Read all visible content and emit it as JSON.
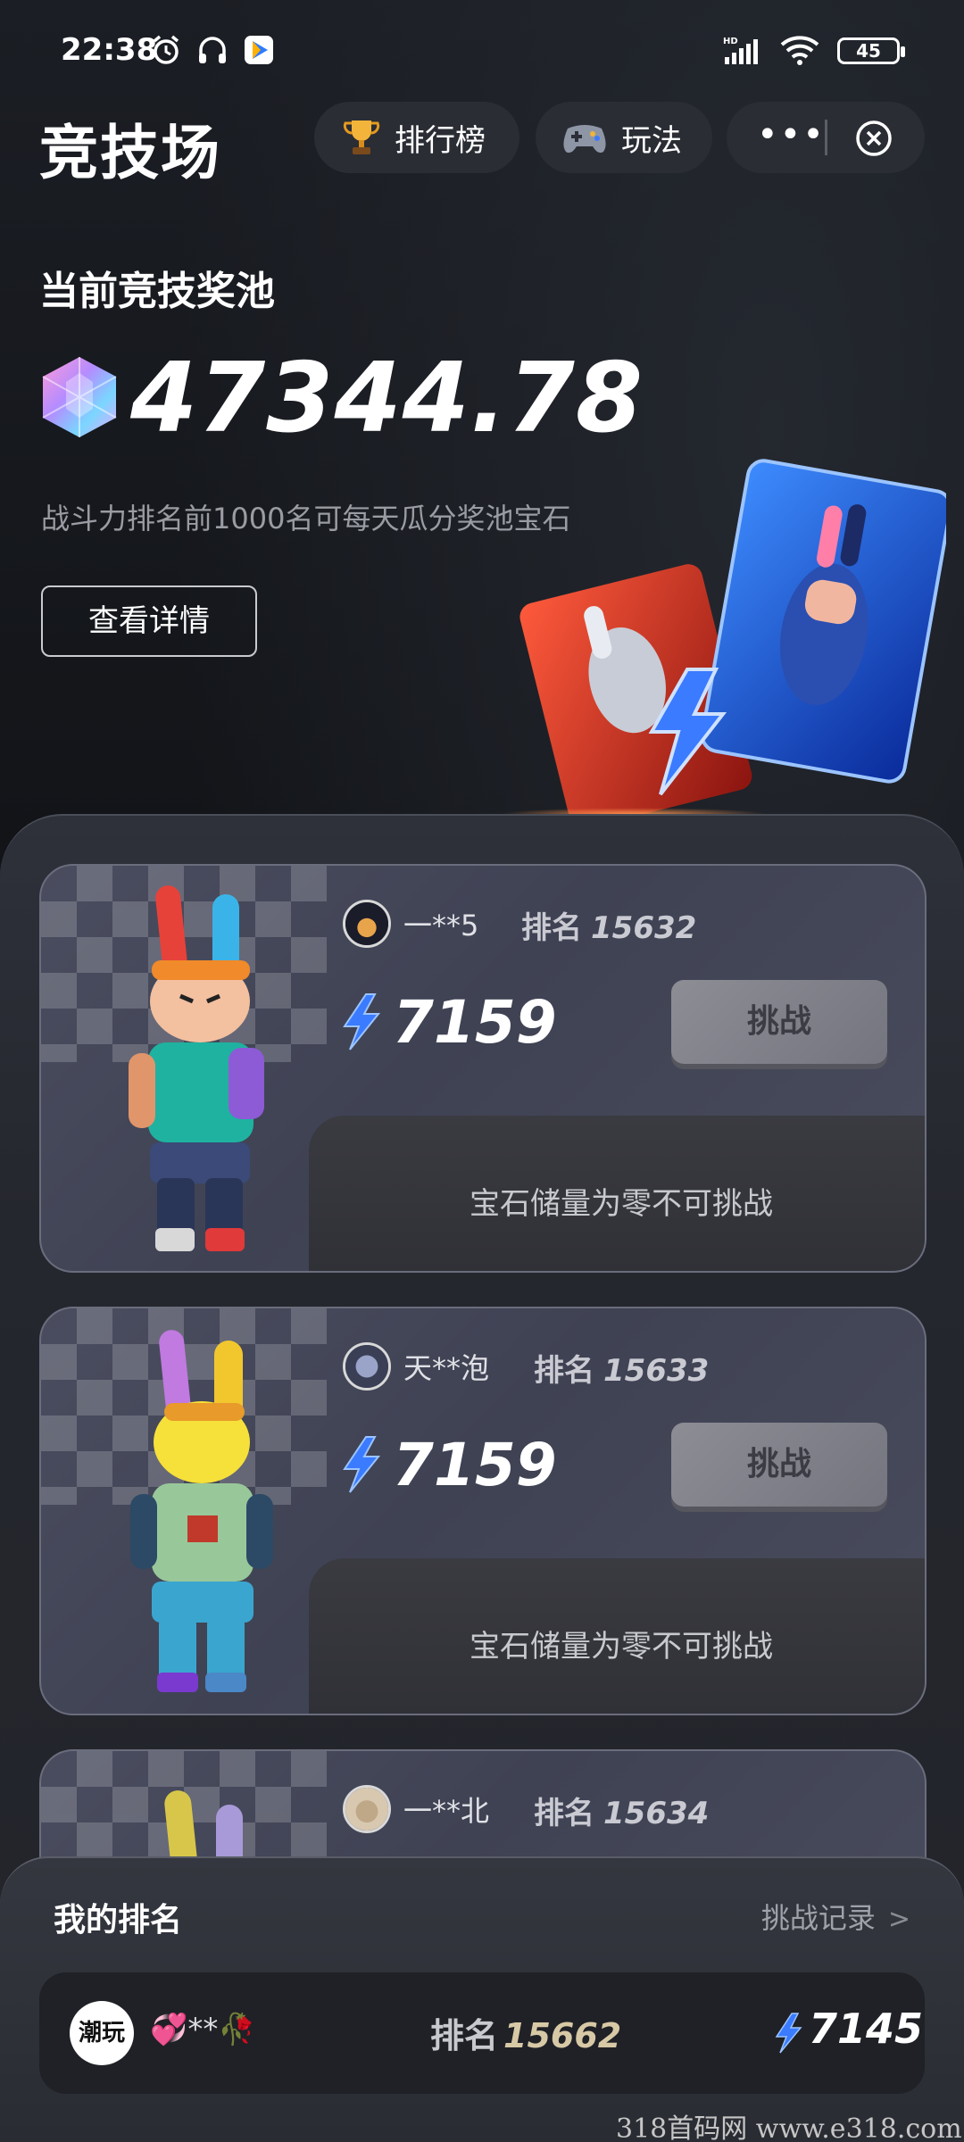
{
  "status_bar": {
    "time": "22:38",
    "battery": "45",
    "network": "HD"
  },
  "header": {
    "title": "竞技场",
    "ranking_label": "排行榜",
    "howto_label": "玩法",
    "more_label": "•••"
  },
  "pool": {
    "title": "当前竞技奖池",
    "amount": "47344.78",
    "description": "战斗力排名前1000名可每天瓜分奖池宝石",
    "details_button": "查看详情"
  },
  "opponents": [
    {
      "name": "一**5",
      "rank_label": "排名",
      "rank": "15632",
      "power": "7159",
      "challenge_label": "挑战",
      "status": "宝石储量为零不可挑战"
    },
    {
      "name": "天**泡",
      "rank_label": "排名",
      "rank": "15633",
      "power": "7159",
      "challenge_label": "挑战",
      "status": "宝石储量为零不可挑战"
    },
    {
      "name": "一**北",
      "rank_label": "排名",
      "rank": "15634"
    }
  ],
  "my_rank": {
    "title": "我的排名",
    "history_link": "挑战记录",
    "avatar_text": "潮玩",
    "name": "💞**🥀",
    "rank_label": "排名",
    "rank": "15662",
    "power": "7145"
  },
  "watermark": "318首码网  www.e318.com",
  "colors": {
    "background": "#16181d",
    "card": "#44475a",
    "power_blue": "#3a7bff",
    "rank_gold": "#d8c9a6"
  }
}
